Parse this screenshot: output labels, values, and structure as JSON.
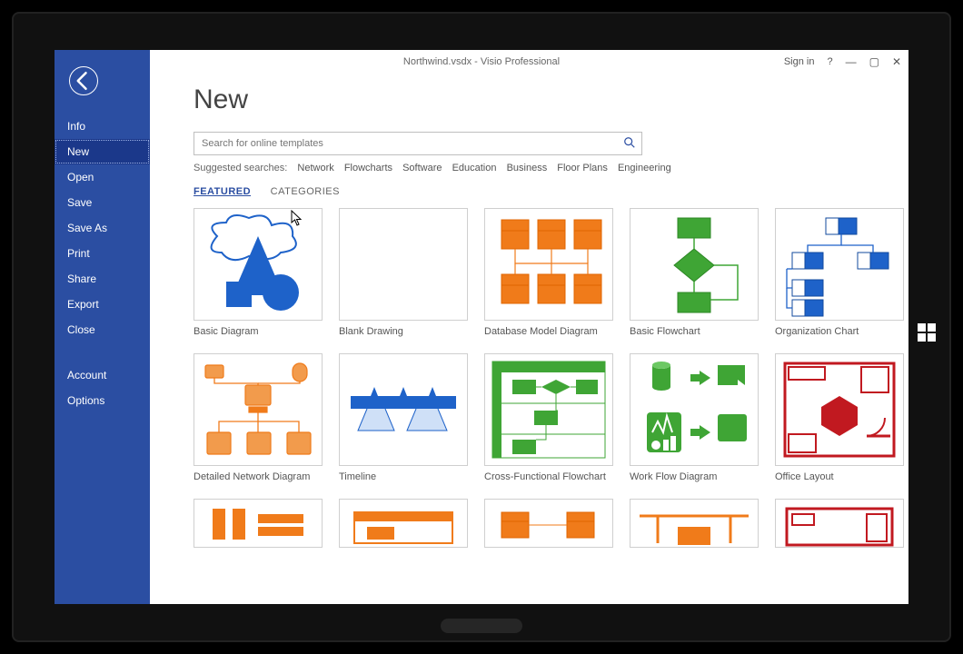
{
  "title": "Northwind.vsdx - Visio Professional",
  "signin": "Sign in",
  "help": "?",
  "page_heading": "New",
  "search": {
    "placeholder": "Search for online templates"
  },
  "suggested_label": "Suggested searches:",
  "suggested": [
    "Network",
    "Flowcharts",
    "Software",
    "Education",
    "Business",
    "Floor Plans",
    "Engineering"
  ],
  "tabs": {
    "featured": "FEATURED",
    "categories": "CATEGORIES"
  },
  "sidebar": {
    "items": [
      "Info",
      "New",
      "Open",
      "Save",
      "Save As",
      "Print",
      "Share",
      "Export",
      "Close"
    ],
    "lower": [
      "Account",
      "Options"
    ],
    "selected": "New"
  },
  "templates_row1": [
    {
      "label": "Basic Diagram"
    },
    {
      "label": "Blank Drawing"
    },
    {
      "label": "Database Model Diagram"
    },
    {
      "label": "Basic Flowchart"
    },
    {
      "label": "Organization Chart"
    }
  ],
  "templates_row2": [
    {
      "label": "Detailed Network Diagram"
    },
    {
      "label": "Timeline"
    },
    {
      "label": "Cross-Functional Flowchart"
    },
    {
      "label": "Work Flow Diagram"
    },
    {
      "label": "Office Layout"
    }
  ]
}
